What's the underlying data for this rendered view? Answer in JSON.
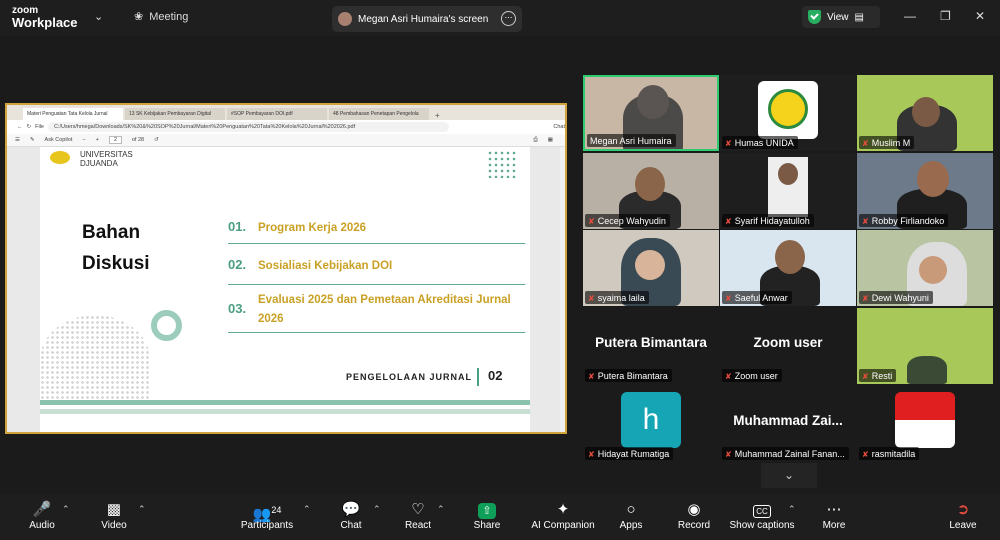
{
  "app": {
    "logo_line1": "zoom",
    "logo_line2": "Workplace",
    "meeting_label": "Meeting"
  },
  "screen_tab": {
    "label": "Megan Asri Humaira's screen"
  },
  "view_button": {
    "label": "View"
  },
  "browser": {
    "tabs": [
      "Materi Penguatan Tata Kelola Jurnal",
      "13 SK Kebijakan Pembayaran Digital",
      "#SOP Pembayaran DOI.pdf",
      "48 Pembahasan Penetapan Pengelola"
    ],
    "url": "C:/Users/hmega/Downloads/SK%20&%20SOP%20Jurnal/Materi%20Penguatan%20Tata%20Kelola%20Jurnal%202026.pdf",
    "file_label": "File",
    "ask_copilot": "Ask Copilot",
    "page_current": "2",
    "page_total": "of 28",
    "chat_label": "Chat"
  },
  "slide": {
    "university": [
      "UNIVERSITAS",
      "DJUANDA"
    ],
    "title_line1": "Bahan",
    "title_line2": "Diskusi",
    "items": [
      {
        "num": "01.",
        "text": "Program Kerja 2026"
      },
      {
        "num": "02.",
        "text": "Sosialiasi Kebijakan DOI"
      },
      {
        "num": "03.",
        "text": "Evaluasi 2025 dan Pemetaan Akreditasi Jurnal 2026"
      }
    ],
    "footer_text": "PENGELOLAAN JURNAL",
    "footer_num": "02"
  },
  "participants_grid": [
    {
      "name": "Megan Asri Humaira",
      "muted": false
    },
    {
      "name": "Humas UNIDA",
      "muted": true
    },
    {
      "name": "Muslim M",
      "muted": true
    },
    {
      "name": "Cecep Wahyudin",
      "muted": true
    },
    {
      "name": "Syarif Hidayatulloh",
      "muted": true
    },
    {
      "name": "Robby Firliandoko",
      "muted": true
    },
    {
      "name": "syaima laila",
      "muted": true
    },
    {
      "name": "Saeful Anwar",
      "muted": true
    },
    {
      "name": "Dewi Wahyuni",
      "muted": true
    },
    {
      "name": "Putera Bimantara",
      "display": "Putera Bimantara",
      "muted": true
    },
    {
      "name": "Zoom user",
      "display": "Zoom user",
      "muted": true
    },
    {
      "name": "Resti",
      "muted": true
    },
    {
      "name": "Hidayat Rumatiga",
      "avatar_letter": "h",
      "muted": true
    },
    {
      "name": "Muhammad Zainal Fanan...",
      "display": "Muhammad  Zai...",
      "muted": true
    },
    {
      "name": "rasmitadila",
      "muted": true
    }
  ],
  "toolbar": {
    "audio": "Audio",
    "video": "Video",
    "participants": "Participants",
    "participants_count": "24",
    "chat": "Chat",
    "react": "React",
    "share": "Share",
    "ai_companion": "AI Companion",
    "apps": "Apps",
    "record": "Record",
    "captions": "Show captions",
    "more": "More",
    "leave": "Leave"
  },
  "colors": {
    "share_green": "#0e9f58",
    "muted_red": "#e74c3c",
    "active_speaker": "#2ecc71",
    "slide_accent": "#5fa892",
    "slide_gold": "#c9a125"
  }
}
